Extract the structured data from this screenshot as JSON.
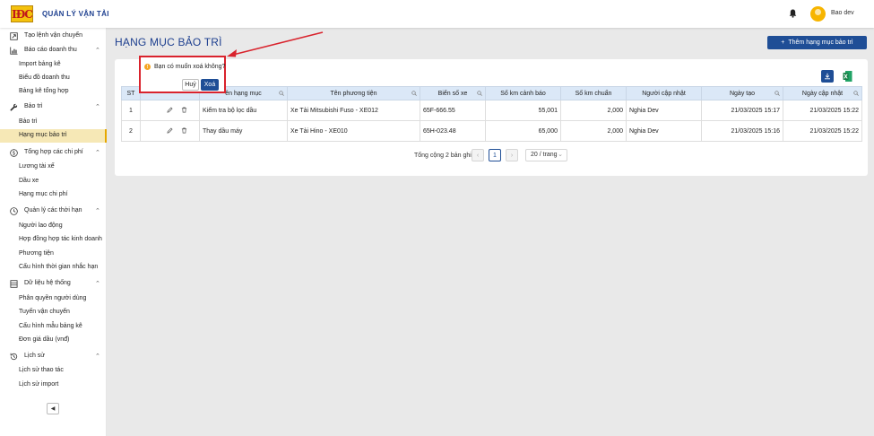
{
  "header": {
    "logo_text": "IĐC",
    "app_title": "QUẢN LÝ VẬN TẢI",
    "username": "Bao dev"
  },
  "sidebar": {
    "groups": [
      {
        "label": "Tạo lệnh vận chuyển",
        "icon": "dispatch-order-icon"
      },
      {
        "label": "Báo cáo doanh thu",
        "icon": "bar-chart-icon",
        "items": [
          "Import bảng kê",
          "Biểu đồ doanh thu",
          "Bảng kê tổng hợp"
        ]
      },
      {
        "label": "Bảo trì",
        "icon": "wrench-icon",
        "items": [
          "Bảo trì",
          "Hạng mục bảo trì"
        ]
      },
      {
        "label": "Tổng hợp các chi phí",
        "icon": "dollar-icon",
        "items": [
          "Lương tài xế",
          "Dầu xe",
          "Hạng mục chi phí"
        ]
      },
      {
        "label": "Quản lý các thời hạn",
        "icon": "clock-icon",
        "items": [
          "Người lao động",
          "Hợp đồng hợp tác kinh doanh",
          "Phương tiện",
          "Cấu hình thời gian nhắc hạn"
        ]
      },
      {
        "label": "Dữ liệu hệ thống",
        "icon": "database-icon",
        "items": [
          "Phân quyền người dùng",
          "Tuyến vận chuyển",
          "Cấu hình mẫu bảng kê",
          "Đơn giá dầu (vnđ)"
        ]
      },
      {
        "label": "Lịch sử",
        "icon": "history-icon",
        "items": [
          "Lịch sử thao tác",
          "Lịch sử import"
        ]
      }
    ],
    "active_item": "Hạng mục bảo trì"
  },
  "page": {
    "title": "HẠNG MỤC BẢO TRÌ",
    "add_button": "Thêm hạng mục bảo trì"
  },
  "table": {
    "columns": [
      "STT",
      "",
      "Tên hạng mục",
      "Tên phương tiện",
      "Biển số xe",
      "Số km cảnh báo",
      "Số km chuẩn",
      "Người cập nhật",
      "Ngày tạo",
      "Ngày cập nhật"
    ],
    "column_visible": [
      "ST",
      "",
      "ên hạng mục",
      "Tên phương tiện",
      "Biển số xe",
      "Số km cảnh báo",
      "Số km chuẩn",
      "Người cập nhật",
      "Ngày tạo",
      "Ngày cập nhật"
    ],
    "rows": [
      {
        "stt": "1",
        "name": "Kiểm tra bộ lọc dầu",
        "vehicle": "Xe Tải Mitsubishi Fuso - XE012",
        "plate": "65F-666.55",
        "warn_km": "55,001",
        "std_km": "2,000",
        "updated_by": "Nghia Dev",
        "created": "21/03/2025 15:17",
        "updated": "21/03/2025 15:22"
      },
      {
        "stt": "2",
        "name": "Thay dầu máy",
        "vehicle": "Xe Tải Hino - XE010",
        "plate": "65H-023.48",
        "warn_km": "65,000",
        "std_km": "2,000",
        "updated_by": "Nghia Dev",
        "created": "21/03/2025 15:16",
        "updated": "21/03/2025 15:22"
      }
    ]
  },
  "pagination": {
    "total": "Tổng cộng 2 bản ghi",
    "current": "1",
    "page_size": "20 / trang"
  },
  "popconfirm": {
    "message": "Bạn có muốn xoá không?",
    "cancel": "Huỷ",
    "ok": "Xoá"
  },
  "colors": {
    "brand": "#1d3f8f",
    "primary": "#1f4e96",
    "active_bg": "#f6e8b6",
    "annotation": "#d9232d"
  }
}
